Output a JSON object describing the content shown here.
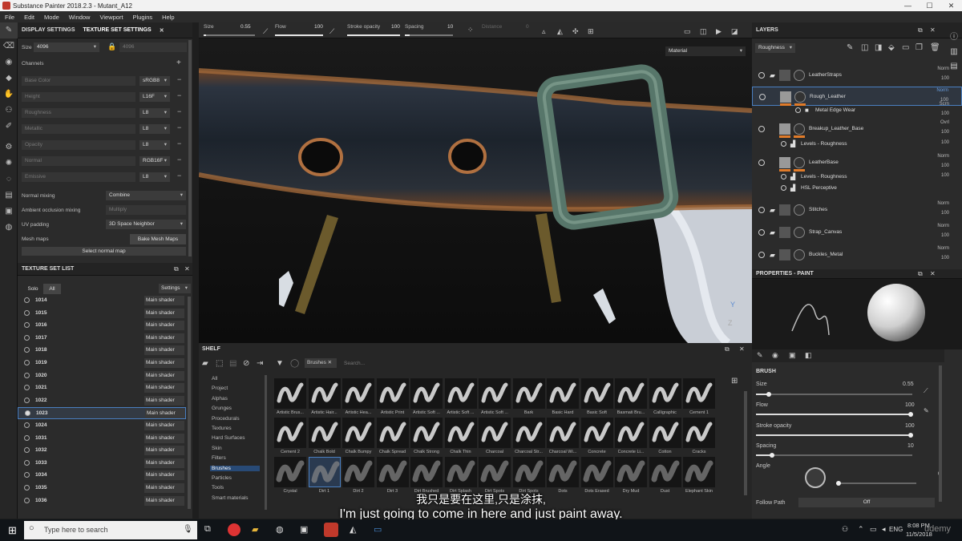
{
  "window": {
    "title": "Substance Painter 2018.2.3 - Mutant_A12",
    "controls": [
      "—",
      "☐",
      "✕"
    ]
  },
  "menu": [
    "File",
    "Edit",
    "Mode",
    "Window",
    "Viewport",
    "Plugins",
    "Help"
  ],
  "toolbar": {
    "size_label": "Size",
    "size_value": "0.55",
    "flow_label": "Flow",
    "flow_value": "100",
    "stroke_label": "Stroke opacity",
    "stroke_value": "100",
    "spacing_label": "Spacing",
    "spacing_value": "10",
    "distance_label": "Distance",
    "distance_value": "0",
    "material_select": "Material"
  },
  "left_panel": {
    "tabs": [
      "DISPLAY SETTINGS",
      "TEXTURE SET SETTINGS"
    ],
    "size_label": "Size",
    "size_value": "4096",
    "size_value2": "4096",
    "channels_label": "Channels",
    "channels": [
      {
        "name": "Base Color",
        "format": "sRGB8"
      },
      {
        "name": "Height",
        "format": "L16F"
      },
      {
        "name": "Roughness",
        "format": "L8"
      },
      {
        "name": "Metallic",
        "format": "L8"
      },
      {
        "name": "Opacity",
        "format": "L8"
      },
      {
        "name": "Normal",
        "format": "RGB16F"
      },
      {
        "name": "Emissive",
        "format": "L8"
      }
    ],
    "normal_mixing_label": "Normal mixing",
    "normal_mixing_value": "Combine",
    "ao_mixing_label": "Ambient occlusion mixing",
    "ao_mixing_value": "Multiply",
    "uv_padding_label": "UV padding",
    "uv_padding_value": "3D Space Neighbor",
    "mesh_maps_label": "Mesh maps",
    "bake_button": "Bake Mesh Maps",
    "select_normal_button": "Select normal map"
  },
  "texture_set_list": {
    "title": "TEXTURE SET LIST",
    "solo": "Solo",
    "all": "All",
    "settings": "Settings",
    "shader_label": "Main shader",
    "rows": [
      "1014",
      "1015",
      "1016",
      "1017",
      "1018",
      "1019",
      "1020",
      "1021",
      "1022",
      "1023",
      "1024",
      "1031",
      "1032",
      "1033",
      "1034",
      "1035",
      "1036"
    ],
    "selected": "1023"
  },
  "shelf": {
    "title": "SHELF",
    "filter_tag": "Brushes",
    "search_placeholder": "Search...",
    "categories": [
      "All",
      "Project",
      "Alphas",
      "Grunges",
      "Procedurals",
      "Textures",
      "Hard Surfaces",
      "Skin",
      "Filters",
      "Brushes",
      "Particles",
      "Tools",
      "Smart materials"
    ],
    "selected_category": "Brushes",
    "row1": [
      "Artistic Brus...",
      "Artistic Hair...",
      "Artistic Hea...",
      "Artistic Print",
      "Artistic Soft ...",
      "Artistic Soft ...",
      "Artistic Soft ...",
      "Bark",
      "Basic Hard",
      "Basic Soft",
      "Basmati Bru...",
      "Calligraphic",
      "Cement 1"
    ],
    "row2": [
      "Cement 2",
      "Chalk Bold",
      "Chalk Bumpy",
      "Chalk Spread",
      "Chalk Strong",
      "Chalk Thin",
      "Charcoal",
      "Charcoal Str...",
      "Charcoal Wi...",
      "Concrete",
      "Concrete Li...",
      "Cotton",
      "Cracks"
    ],
    "row3": [
      "Crystal",
      "Dirt 1",
      "Dirt 2",
      "Dirt 3",
      "Dirt Brushed",
      "Dirt Splash",
      "Dirt Spots",
      "Dirt Spots",
      "Dots",
      "Dots Erased",
      "Dry Mud",
      "Dust",
      "Elephant Skin"
    ]
  },
  "layers": {
    "title": "LAYERS",
    "channel_select": "Roughness",
    "items": [
      {
        "name": "LeatherStraps",
        "blend": "Norm",
        "opacity": "100",
        "type": "folder"
      },
      {
        "name": "Rough_Leather",
        "blend": "Norm",
        "opacity": "100",
        "type": "fill",
        "selected": true
      },
      {
        "name": "Metal Edge Wear",
        "blend": "Scrn",
        "opacity": "100",
        "type": "sub"
      },
      {
        "name": "Breakup_Leather_Base",
        "blend": "Ovrl",
        "opacity": "100",
        "type": "fill"
      },
      {
        "name": "Levels - Roughness",
        "blend": "",
        "opacity": "100",
        "type": "effect"
      },
      {
        "name": "LeatherBase",
        "blend": "Norm",
        "opacity": "100",
        "type": "fill"
      },
      {
        "name": "Levels - Roughness",
        "blend": "",
        "opacity": "100",
        "type": "effect"
      },
      {
        "name": "HSL Perceptive",
        "blend": "",
        "opacity": "",
        "type": "effect"
      },
      {
        "name": "Stitches",
        "blend": "Norm",
        "opacity": "100",
        "type": "folder"
      },
      {
        "name": "Strap_Canvas",
        "blend": "Norm",
        "opacity": "100",
        "type": "folder"
      },
      {
        "name": "Buckles_Metal",
        "blend": "Norm",
        "opacity": "100",
        "type": "folder"
      }
    ]
  },
  "properties": {
    "title": "PROPERTIES - PAINT",
    "brush_title": "BRUSH",
    "size_label": "Size",
    "size_value": "0.55",
    "size_pct": 0.08,
    "flow_label": "Flow",
    "flow_value": "100",
    "stroke_label": "Stroke opacity",
    "stroke_value": "100",
    "spacing_label": "Spacing",
    "spacing_value": "10",
    "spacing_pct": 0.1,
    "angle_label": "Angle",
    "angle_value": "0",
    "follow_label": "Follow Path",
    "follow_value": "Off"
  },
  "subtitles": {
    "chinese": "我只是要在这里,只是涂抹,",
    "english": "I'm just going to come in here and just paint away."
  },
  "taskbar": {
    "search_placeholder": "Type here to search",
    "lang": "ENG",
    "time": "8:08 PM",
    "date": "11/5/2018",
    "watermark": "udemy"
  }
}
